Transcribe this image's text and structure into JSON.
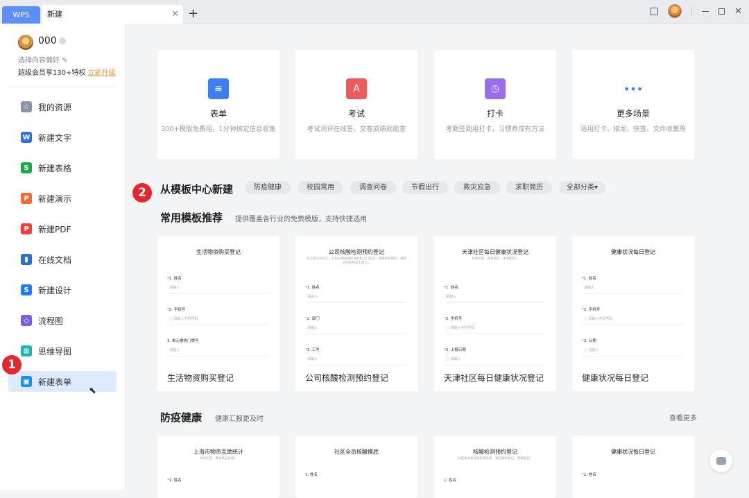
{
  "titlebar": {
    "wps_tab": "WPS",
    "doc_tab": "新建",
    "close_glyph": "✕",
    "plus_glyph": "+"
  },
  "profile": {
    "name": "000",
    "prefs": "选择内容偏好 ✎",
    "vip_text": "超级会员享130+特权",
    "vip_link": "立即升级"
  },
  "sidebar": {
    "items": [
      {
        "label": "我的资源",
        "icon": "star-icon",
        "color": "#8a94a6",
        "glyph": "☆"
      },
      {
        "label": "新建文字",
        "icon": "word-icon",
        "color": "#2f6fe4",
        "glyph": "W"
      },
      {
        "label": "新建表格",
        "icon": "sheet-icon",
        "color": "#1ea84a",
        "glyph": "S"
      },
      {
        "label": "新建演示",
        "icon": "ppt-icon",
        "color": "#f36a35",
        "glyph": "P"
      },
      {
        "label": "新建PDF",
        "icon": "pdf-icon",
        "color": "#ef3e3e",
        "glyph": "P"
      },
      {
        "label": "在线文档",
        "icon": "cloud-doc-icon",
        "color": "#2a6fd6",
        "glyph": "▮"
      },
      {
        "label": "新建设计",
        "icon": "design-icon",
        "color": "#1f7cf5",
        "glyph": "S"
      },
      {
        "label": "流程图",
        "icon": "flowchart-icon",
        "color": "#7d5de6",
        "glyph": "◇"
      },
      {
        "label": "思维导图",
        "icon": "mindmap-icon",
        "color": "#1bb5b1",
        "glyph": "⊞"
      },
      {
        "label": "新建表单",
        "icon": "form-icon",
        "color": "#1b8ff0",
        "glyph": "▣"
      }
    ]
  },
  "quick_cards": [
    {
      "title": "表单",
      "sub": "300+模版免费用，1分钟搞定信息收集",
      "color": "#3d7ef5",
      "glyph": "≡"
    },
    {
      "title": "考试",
      "sub": "考试测评在线答，交卷成绩就能查",
      "color": "#ef5b5b",
      "glyph": "A"
    },
    {
      "title": "打卡",
      "sub": "考勤签到用打卡，习惯养成有方法",
      "color": "#9a6cf0",
      "glyph": "◷"
    },
    {
      "title": "更多场景",
      "sub": "适用打卡、接龙、快查、文件收集等",
      "color": "#3d7ef5",
      "glyph": "•••"
    }
  ],
  "template_center": {
    "title": "从模板中心新建",
    "pills": [
      "防疫健康",
      "校园常用",
      "调查问卷",
      "节假出行",
      "救灾应急",
      "求职简历",
      "全部分类▾"
    ]
  },
  "recommended": {
    "title": "常用模板推荐",
    "sub": "提供覆盖各行业的免费模版，支持快捷选用"
  },
  "templates": [
    {
      "form_title": "生活物资购买登记",
      "form_sub": "",
      "name": "生活物资购买登记",
      "fields": [
        {
          "label": "1. 姓名",
          "req": "*",
          "ph": "请输入"
        },
        {
          "label": "2. 手机号",
          "req": "*",
          "ph": "▢  请输入手机号码"
        },
        {
          "label": "3. 单元楼栋门牌号",
          "req": "",
          "ph": "请输入"
        }
      ]
    },
    {
      "form_title": "公司核酸检测预约登记",
      "form_sub": "为方便公司员工，公司拟请核酸检测机构上门检测，需要提前预约，请配合完成并如实填写。",
      "name": "公司核酸检测预约登记",
      "fields": [
        {
          "label": "1. 姓名",
          "req": "*",
          "ph": "请输入"
        },
        {
          "label": "2. 部门",
          "req": "*",
          "ph": "请输入"
        },
        {
          "label": "3. 工号",
          "req": "*",
          "ph": "请输入"
        }
      ]
    },
    {
      "form_title": "天津社区每日健康状况登记",
      "form_sub": "共同抗疫，每日填写，谢谢配合！",
      "name": "天津社区每日健康状况登记",
      "fields": [
        {
          "label": "1. 姓名",
          "req": "*",
          "ph": "请输入"
        },
        {
          "label": "2. 手机号",
          "req": "*",
          "ph": "▢  请输入手机号码"
        },
        {
          "label": "3. 上报日期",
          "req": "*",
          "ph": "▢  请输入"
        }
      ]
    },
    {
      "form_title": "健康状况每日登记",
      "form_sub": "",
      "name": "健康状况每日登记",
      "fields": [
        {
          "label": "1. 姓名",
          "req": "*",
          "ph": "请输入"
        },
        {
          "label": "2. 手机号",
          "req": "*",
          "ph": "▢  请输入手机号码"
        },
        {
          "label": "3. 日期",
          "req": "*",
          "ph": "▢  请输入"
        }
      ]
    }
  ],
  "health": {
    "title": "防疫健康",
    "sub": "健康汇报更及时",
    "more": "查看更多"
  },
  "health_templates": [
    {
      "form_title": "上海市物资互助统计",
      "form_sub": "共同守望，携手抗击疫情！",
      "field": "1. 姓名",
      "req": "*"
    },
    {
      "form_title": "社区全员核酸摸底",
      "form_sub": "",
      "field": "1. 姓名",
      "req": ""
    },
    {
      "form_title": "核酸检测预约登记",
      "form_sub": "为提高大家核酸检测效率，请先预约登记，谢谢配合！",
      "field": "1. 姓名",
      "req": ""
    },
    {
      "form_title": "健康状况每日登记",
      "form_sub": "",
      "field": "1. 姓名",
      "req": "*"
    }
  ],
  "annotations": [
    "1",
    "2"
  ]
}
